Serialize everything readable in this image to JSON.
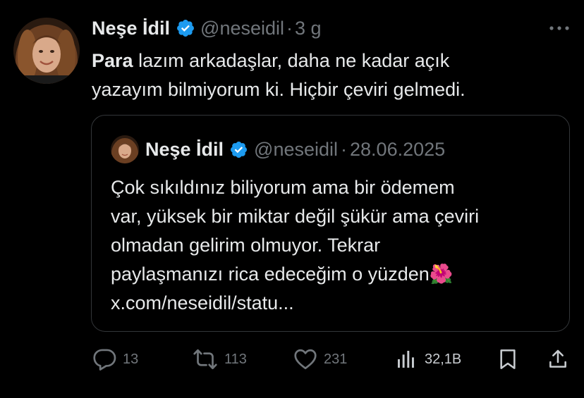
{
  "tweet": {
    "author_name": "Neşe İdil",
    "handle": "@neseidil",
    "separator": "·",
    "time": "3 g",
    "text_bold": "Para",
    "text_rest_line1": " lazım arkadaşlar, daha ne kadar açık",
    "text_line2": "yazayım bilmiyorum ki. Hiçbir çeviri gelmedi."
  },
  "quote": {
    "author_name": "Neşe İdil",
    "handle": "@neseidil",
    "separator": "·",
    "date": "28.06.2025",
    "lines": [
      "Çok sıkıldınız biliyorum ama bir ödemem",
      "var, yüksek bir miktar değil şükür ama çeviri",
      "olmadan gelirim olmuyor. Tekrar",
      "paylaşmanızı rica edeceğim o yüzden🌺",
      "x.com/neseidil/statu..."
    ]
  },
  "actions": {
    "replies": "13",
    "retweets": "113",
    "likes": "231",
    "views": "32,1B"
  },
  "colors": {
    "background": "#000000",
    "text": "#e7e9ea",
    "muted": "#71767b",
    "verified": "#1d9bf0",
    "border": "#333639"
  }
}
